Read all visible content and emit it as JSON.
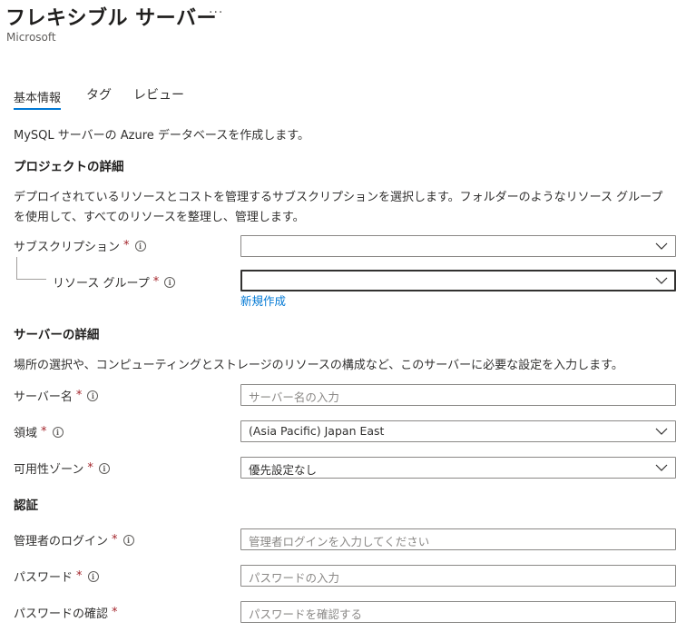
{
  "header": {
    "title": "フレキシブル サーバー",
    "more": "···",
    "subtitle": "Microsoft"
  },
  "tabs": [
    {
      "label": "基本情報",
      "active": true
    },
    {
      "label": "タグ",
      "active": false
    },
    {
      "label": "レビュー",
      "active": false
    }
  ],
  "intro": "MySQL サーバーの Azure データベースを作成します。",
  "project": {
    "heading": "プロジェクトの詳細",
    "description_line1": "デプロイされているリソースとコストを管理するサブスクリプションを選択します。フォルダーのようなリソース グループ",
    "description_line2": "を使用して、すべてのリソースを整理し、管理します。",
    "subscription_label": "サブスクリプション",
    "subscription_value": "",
    "resource_group_label": "リソース グループ",
    "resource_group_value": "",
    "create_new": "新規作成"
  },
  "server": {
    "heading": "サーバーの詳細",
    "description": "場所の選択や、コンピューティングとストレージのリソースの構成など、このサーバーに必要な設定を入力します。",
    "name_label": "サーバー名",
    "name_placeholder": "サーバー名の入力",
    "region_label": "領域",
    "region_value": "(Asia Pacific) Japan East",
    "zone_label": "可用性ゾーン",
    "zone_value": "優先設定なし"
  },
  "auth": {
    "heading": "認証",
    "admin_label": "管理者のログイン",
    "admin_placeholder": "管理者ログインを入力してください",
    "password_label": "パスワード",
    "password_placeholder": "パスワードの入力",
    "confirm_label": "パスワードの確認",
    "confirm_placeholder": "パスワードを確認する"
  },
  "required_mark": "*",
  "info_glyph": "i",
  "colors": {
    "accent": "#0078d4",
    "required": "#a4262c",
    "border": "#8a8886",
    "placeholder": "#8a8886"
  }
}
